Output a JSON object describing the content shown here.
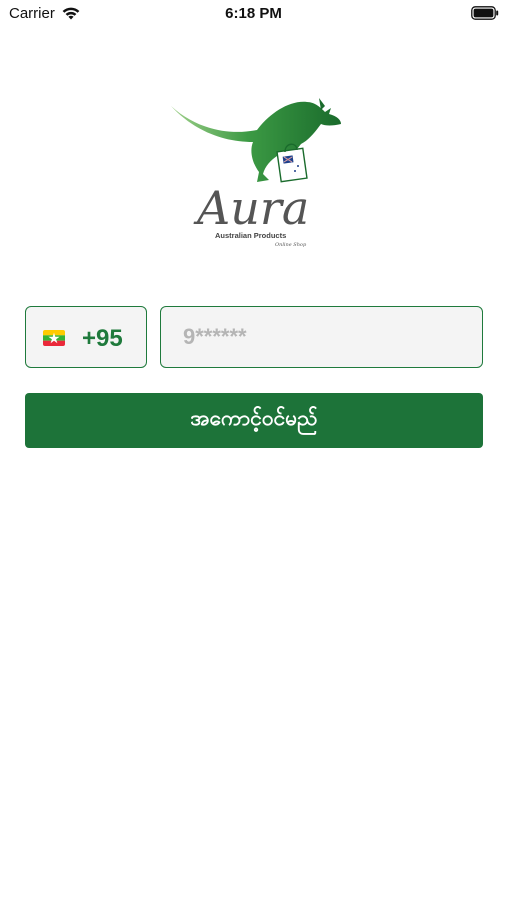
{
  "status_bar": {
    "carrier": "Carrier",
    "time": "6:18 PM",
    "wifi_icon": "wifi-icon",
    "battery_icon": "battery-icon"
  },
  "logo": {
    "brand": "Aura",
    "tagline": "Australian Products",
    "sub_tagline": "Online Shop",
    "icon": "kangaroo-icon",
    "green": "#2e8b3a",
    "dark_green": "#1a6b2c"
  },
  "phone_form": {
    "country_flag": "myanmar-flag-icon",
    "dial_code": "+95",
    "phone_placeholder": "9******",
    "phone_value": ""
  },
  "login_button": {
    "label": "အကောင့်ဝင်မည်"
  },
  "colors": {
    "accent": "#1d7339",
    "border": "#1f7a3c",
    "field_bg": "#f4f4f4",
    "background": "#ffffff"
  }
}
